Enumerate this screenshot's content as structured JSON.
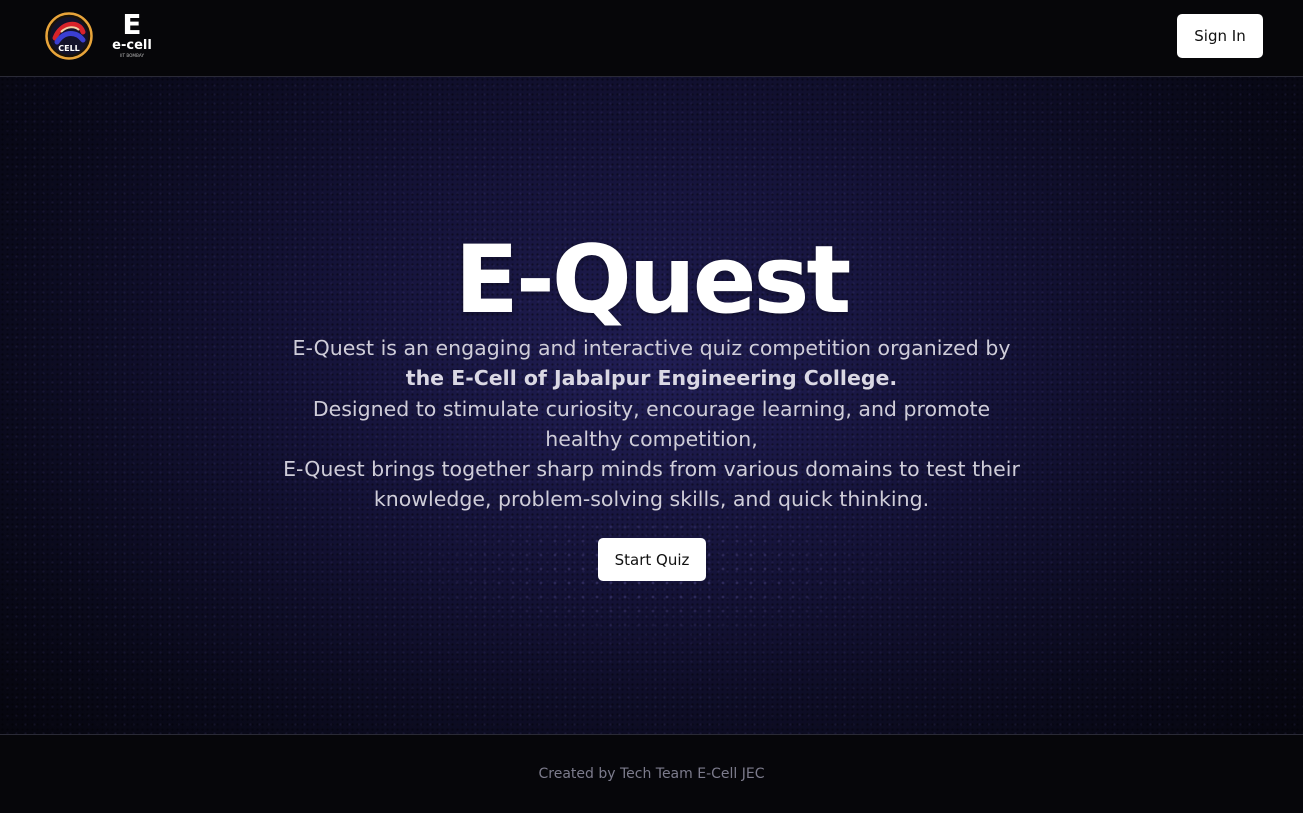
{
  "header": {
    "logos": [
      {
        "icon": "jec-ecell-logo",
        "text": "CELL"
      },
      {
        "icon": "ecell-iit-bombay-logo",
        "mark": "E",
        "text": "e-cell",
        "subtext": "IIT BOMBAY"
      }
    ],
    "signin_label": "Sign In"
  },
  "hero": {
    "title": "E-Quest",
    "description_lines": [
      "E-Quest is an engaging and interactive quiz competition organized by",
      "the E-Cell of Jabalpur Engineering College.",
      "Designed to stimulate curiosity, encourage learning, and promote",
      "healthy competition,",
      "E-Quest brings together sharp minds from various domains to test their",
      "knowledge, problem-solving skills, and quick thinking."
    ],
    "start_label": "Start Quiz"
  },
  "footer": {
    "credit": "Created by Tech Team E-Cell JEC"
  },
  "colors": {
    "background": "#05050b",
    "hero_glow": "#221f58",
    "button_bg": "#ffffff",
    "button_text": "#111111",
    "description_text": "#cfcdd9",
    "footer_text": "#7c7b8c",
    "logo_ring": "#e8a43a"
  }
}
